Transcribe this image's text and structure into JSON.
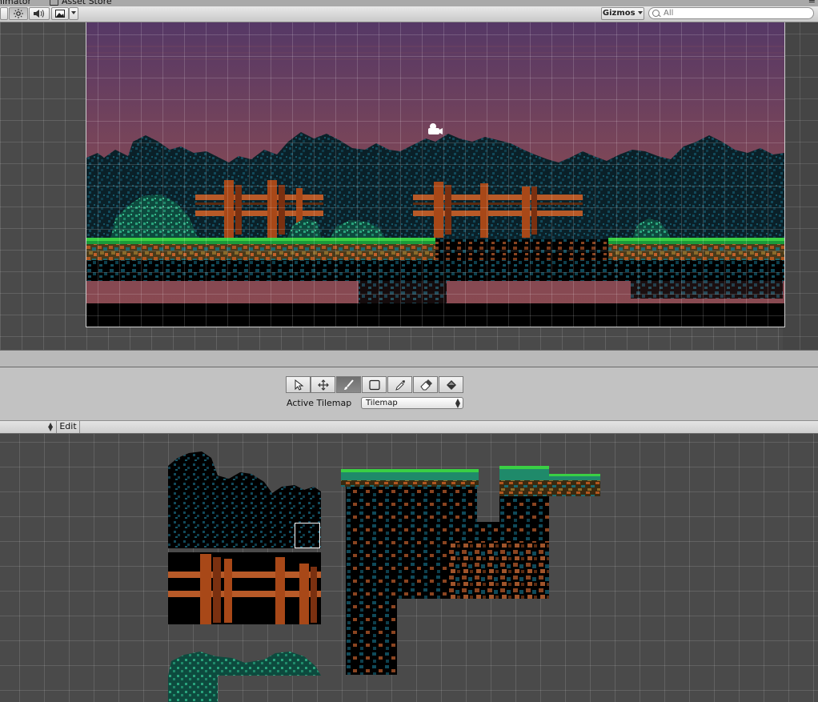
{
  "tabs": {
    "animator": "nimator",
    "asset_store": "Asset Store"
  },
  "scene_toolbar": {
    "gizmos_label": "Gizmos",
    "search_placeholder": "All"
  },
  "tilemap_tools": {
    "active_tilemap_label": "Active Tilemap",
    "active_tilemap_value": "Tilemap",
    "selected_tool": "paint-brush",
    "tools": [
      "select-icon",
      "move-icon",
      "paint-brush-icon",
      "box-fill-icon",
      "picker-icon",
      "eraser-icon",
      "fill-icon"
    ]
  },
  "palette": {
    "edit_label": "Edit"
  },
  "colors": {
    "sky_top": "#5a3a68",
    "sky_bottom": "#8a4a52",
    "foliage_dark": "#0f3a46",
    "foliage_teal": "#1f8a6a",
    "grass_green": "#3ad044",
    "dirt_orange": "#b0561f",
    "stone_blue": "#0f4a5a",
    "fence_brown": "#a84818"
  }
}
